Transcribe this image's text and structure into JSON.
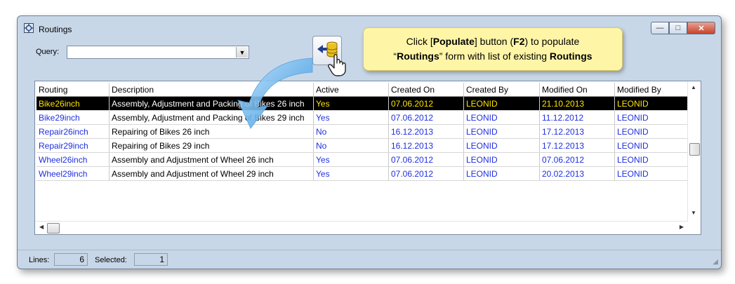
{
  "window": {
    "title": "Routings",
    "buttons": {
      "minimize": "—",
      "maximize": "□",
      "close": "✕"
    }
  },
  "query": {
    "label": "Query:",
    "value": ""
  },
  "toolbar": {
    "populate_icon": "populate-db-icon"
  },
  "callout": {
    "line1_pre": "Click [",
    "line1_bold1": "Populate",
    "line1_mid": "] button (",
    "line1_bold2": "F2",
    "line1_post": ") to populate",
    "line2_pre": "“",
    "line2_bold1": "Routings",
    "line2_mid": "” form with list of existing ",
    "line2_bold2": "Routings"
  },
  "grid": {
    "columns": [
      "Routing",
      "Description",
      "Active",
      "Created On",
      "Created By",
      "Modified On",
      "Modified By"
    ],
    "rows": [
      {
        "routing": "Bike26inch",
        "description": "Assembly, Adjustment and Packing of Bikes 26 inch",
        "active": "Yes",
        "created_on": "07.06.2012",
        "created_by": "LEONID",
        "modified_on": "21.10.2013",
        "modified_by": "LEONID",
        "selected": true
      },
      {
        "routing": "Bike29inch",
        "description": "Assembly, Adjustment and Packing of Bikes 29 inch",
        "active": "Yes",
        "created_on": "07.06.2012",
        "created_by": "LEONID",
        "modified_on": "11.12.2012",
        "modified_by": "LEONID",
        "selected": false
      },
      {
        "routing": "Repair26inch",
        "description": "Repairing of Bikes 26 inch",
        "active": "No",
        "created_on": "16.12.2013",
        "created_by": "LEONID",
        "modified_on": "17.12.2013",
        "modified_by": "LEONID",
        "selected": false
      },
      {
        "routing": "Repair29inch",
        "description": "Repairing of Bikes 29 inch",
        "active": "No",
        "created_on": "16.12.2013",
        "created_by": "LEONID",
        "modified_on": "17.12.2013",
        "modified_by": "LEONID",
        "selected": false
      },
      {
        "routing": "Wheel26inch",
        "description": "Assembly and Adjustment of Wheel 26 inch",
        "active": "Yes",
        "created_on": "07.06.2012",
        "created_by": "LEONID",
        "modified_on": "07.06.2012",
        "modified_by": "LEONID",
        "selected": false
      },
      {
        "routing": "Wheel29inch",
        "description": "Assembly and Adjustment of Wheel 29 inch",
        "active": "Yes",
        "created_on": "07.06.2012",
        "created_by": "LEONID",
        "modified_on": "20.02.2013",
        "modified_by": "LEONID",
        "selected": false
      }
    ]
  },
  "status": {
    "lines_label": "Lines:",
    "lines_value": "6",
    "selected_label": "Selected:",
    "selected_value": "1"
  },
  "colors": {
    "window_bg": "#c8d7e8",
    "row_text": "#1f2fe0",
    "selected_bg": "#000000",
    "selected_text": "#ffe400",
    "callout_bg": "#fff5a7"
  }
}
